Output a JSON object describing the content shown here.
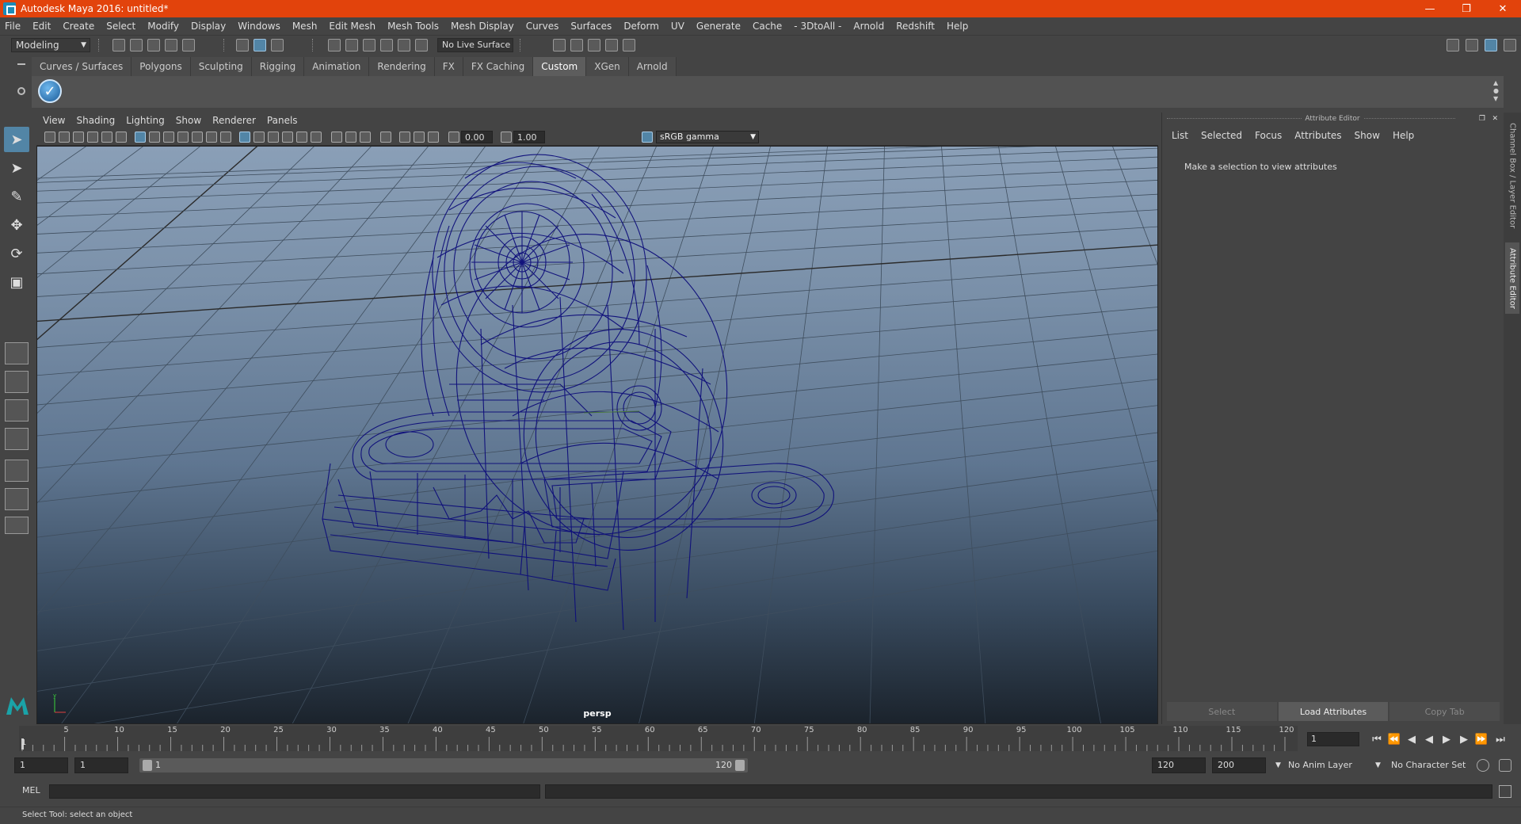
{
  "window": {
    "title": "Autodesk Maya 2016: untitled*"
  },
  "menubar": [
    "File",
    "Edit",
    "Create",
    "Select",
    "Modify",
    "Display",
    "Windows",
    "Mesh",
    "Edit Mesh",
    "Mesh Tools",
    "Mesh Display",
    "Curves",
    "Surfaces",
    "Deform",
    "UV",
    "Generate",
    "Cache",
    "- 3DtoAll -",
    "Arnold",
    "Redshift",
    "Help"
  ],
  "statusline": {
    "mode": "Modeling",
    "live_surface": "No Live Surface"
  },
  "shelf": {
    "tabs": [
      "Curves / Surfaces",
      "Polygons",
      "Sculpting",
      "Rigging",
      "Animation",
      "Rendering",
      "FX",
      "FX Caching",
      "Custom",
      "XGen",
      "Arnold"
    ],
    "active_tab": "Custom"
  },
  "viewport": {
    "menu": [
      "View",
      "Shading",
      "Lighting",
      "Show",
      "Renderer",
      "Panels"
    ],
    "exposure": "0.00",
    "gamma": "1.00",
    "color_space": "sRGB gamma",
    "camera_label": "persp"
  },
  "attribute_editor": {
    "title": "Attribute Editor",
    "menu": [
      "List",
      "Selected",
      "Focus",
      "Attributes",
      "Show",
      "Help"
    ],
    "message": "Make a selection to view attributes",
    "buttons": {
      "select": "Select",
      "load": "Load Attributes",
      "copy": "Copy Tab"
    }
  },
  "side_tabs": {
    "channel_box": "Channel Box / Layer Editor",
    "attribute_editor": "Attribute Editor"
  },
  "timeslider": {
    "ticks": [
      "5",
      "10",
      "15",
      "20",
      "25",
      "30",
      "35",
      "40",
      "45",
      "50",
      "55",
      "60",
      "65",
      "70",
      "75",
      "80",
      "85",
      "90",
      "95",
      "100",
      "105",
      "110",
      "115",
      "120"
    ],
    "start_label": "1",
    "current_frame": "1"
  },
  "range": {
    "start": "1",
    "playback_start": "1",
    "bar_start": "1",
    "bar_end": "120",
    "playback_end": "120",
    "end": "200",
    "anim_layer": "No Anim Layer",
    "character_set": "No Character Set"
  },
  "command": {
    "label": "MEL"
  },
  "help_line": "Select Tool: select an object",
  "icons": [
    "select-tool-icon",
    "lasso-tool-icon",
    "paint-select-icon",
    "move-tool-icon",
    "rotate-tool-icon",
    "scale-tool-icon",
    "maya-logo-icon",
    "play-forward-icon",
    "play-back-icon",
    "step-forward-icon",
    "step-back-icon",
    "go-to-start-icon",
    "go-to-end-icon"
  ]
}
